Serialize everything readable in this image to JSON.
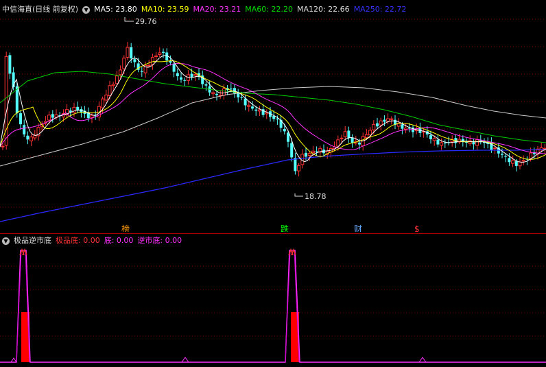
{
  "stock": {
    "title": "中信海直(日线 前复权)"
  },
  "ma_legend": [
    {
      "label": "MA5: 23.80",
      "color": "#ffffff"
    },
    {
      "label": "MA10: 23.59",
      "color": "#ffff00"
    },
    {
      "label": "MA20: 23.21",
      "color": "#ff33ff"
    },
    {
      "label": "MA60: 22.20",
      "color": "#00dd00"
    },
    {
      "label": "MA120: 22.66",
      "color": "#dddddd"
    },
    {
      "label": "MA250: 22.72",
      "color": "#3333ff"
    }
  ],
  "price_marks": {
    "high": "29.76",
    "low": "18.78"
  },
  "event_markers": [
    {
      "text": "榜",
      "color": "#ff9900"
    },
    {
      "text": "跌",
      "color": "#00ff00"
    },
    {
      "text": "财",
      "color": "#66aaff"
    },
    {
      "text": "$",
      "color": "#ff3333"
    }
  ],
  "indicator": {
    "name": "极品逆市底",
    "items": [
      {
        "label": "极品底: 0.00",
        "color": "#ff3333"
      },
      {
        "label": "底: 0.00",
        "color": "#ff33ff"
      },
      {
        "label": "逆市底: 0.00",
        "color": "#ff33ff"
      }
    ]
  },
  "colors": {
    "up": "#ff3232",
    "down": "#54ffff",
    "grid": "#7a0000"
  }
}
